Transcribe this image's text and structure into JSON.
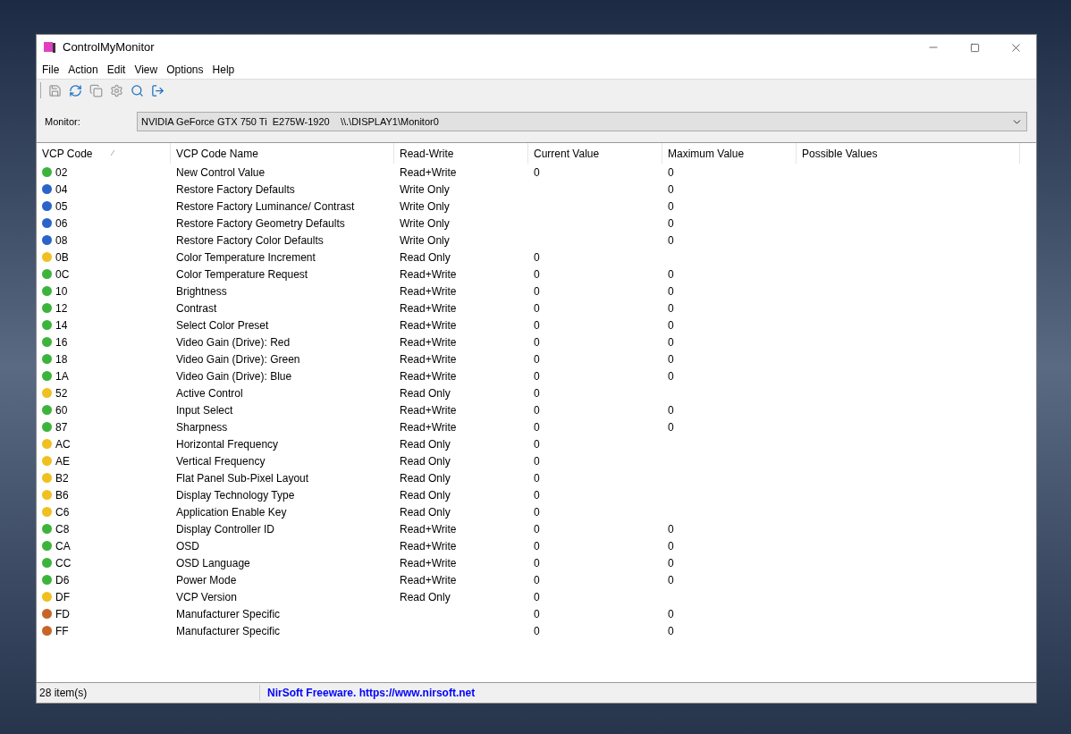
{
  "window": {
    "title": "ControlMyMonitor"
  },
  "menu": [
    "File",
    "Action",
    "Edit",
    "View",
    "Options",
    "Help"
  ],
  "toolbar": [
    {
      "kind": "save",
      "disabled": true
    },
    {
      "kind": "refresh",
      "disabled": false
    },
    {
      "kind": "copy",
      "disabled": true
    },
    {
      "kind": "properties",
      "disabled": true
    },
    {
      "kind": "find",
      "disabled": false
    },
    {
      "kind": "exit",
      "disabled": false
    }
  ],
  "monitor": {
    "label": "Monitor:",
    "value": "NVIDIA GeForce GTX 750 Ti  E275W-1920    \\\\.\\DISPLAY1\\Monitor0"
  },
  "table": {
    "columns": [
      "VCP Code",
      "VCP Code Name",
      "Read-Write",
      "Current Value",
      "Maximum Value",
      "Possible Values"
    ],
    "sort_mark": "⁄",
    "rows": [
      {
        "code": "02",
        "name": "New Control Value",
        "rw": "Read+Write",
        "current": "0",
        "max": "0",
        "color": "#3cb43c"
      },
      {
        "code": "04",
        "name": "Restore Factory Defaults",
        "rw": "Write Only",
        "current": "",
        "max": "0",
        "color": "#2a64c8"
      },
      {
        "code": "05",
        "name": "Restore Factory Luminance/ Contrast",
        "rw": "Write Only",
        "current": "",
        "max": "0",
        "color": "#2a64c8"
      },
      {
        "code": "06",
        "name": "Restore Factory Geometry Defaults",
        "rw": "Write Only",
        "current": "",
        "max": "0",
        "color": "#2a64c8"
      },
      {
        "code": "08",
        "name": "Restore Factory Color Defaults",
        "rw": "Write Only",
        "current": "",
        "max": "0",
        "color": "#2a64c8"
      },
      {
        "code": "0B",
        "name": "Color Temperature Increment",
        "rw": "Read Only",
        "current": "0",
        "max": "",
        "color": "#f0c020"
      },
      {
        "code": "0C",
        "name": "Color Temperature Request",
        "rw": "Read+Write",
        "current": "0",
        "max": "0",
        "color": "#3cb43c"
      },
      {
        "code": "10",
        "name": "Brightness",
        "rw": "Read+Write",
        "current": "0",
        "max": "0",
        "color": "#3cb43c"
      },
      {
        "code": "12",
        "name": "Contrast",
        "rw": "Read+Write",
        "current": "0",
        "max": "0",
        "color": "#3cb43c"
      },
      {
        "code": "14",
        "name": "Select Color Preset",
        "rw": "Read+Write",
        "current": "0",
        "max": "0",
        "color": "#3cb43c"
      },
      {
        "code": "16",
        "name": "Video Gain (Drive): Red",
        "rw": "Read+Write",
        "current": "0",
        "max": "0",
        "color": "#3cb43c"
      },
      {
        "code": "18",
        "name": "Video Gain (Drive): Green",
        "rw": "Read+Write",
        "current": "0",
        "max": "0",
        "color": "#3cb43c"
      },
      {
        "code": "1A",
        "name": "Video Gain (Drive): Blue",
        "rw": "Read+Write",
        "current": "0",
        "max": "0",
        "color": "#3cb43c"
      },
      {
        "code": "52",
        "name": "Active Control",
        "rw": "Read Only",
        "current": "0",
        "max": "",
        "color": "#f0c020"
      },
      {
        "code": "60",
        "name": "Input Select",
        "rw": "Read+Write",
        "current": "0",
        "max": "0",
        "color": "#3cb43c"
      },
      {
        "code": "87",
        "name": "Sharpness",
        "rw": "Read+Write",
        "current": "0",
        "max": "0",
        "color": "#3cb43c"
      },
      {
        "code": "AC",
        "name": "Horizontal Frequency",
        "rw": "Read Only",
        "current": "0",
        "max": "",
        "color": "#f0c020"
      },
      {
        "code": "AE",
        "name": "Vertical Frequency",
        "rw": "Read Only",
        "current": "0",
        "max": "",
        "color": "#f0c020"
      },
      {
        "code": "B2",
        "name": "Flat Panel Sub-Pixel Layout",
        "rw": "Read Only",
        "current": "0",
        "max": "",
        "color": "#f0c020"
      },
      {
        "code": "B6",
        "name": "Display Technology Type",
        "rw": "Read Only",
        "current": "0",
        "max": "",
        "color": "#f0c020"
      },
      {
        "code": "C6",
        "name": "Application Enable Key",
        "rw": "Read Only",
        "current": "0",
        "max": "",
        "color": "#f0c020"
      },
      {
        "code": "C8",
        "name": "Display Controller ID",
        "rw": "Read+Write",
        "current": "0",
        "max": "0",
        "color": "#3cb43c"
      },
      {
        "code": "CA",
        "name": "OSD",
        "rw": "Read+Write",
        "current": "0",
        "max": "0",
        "color": "#3cb43c"
      },
      {
        "code": "CC",
        "name": "OSD Language",
        "rw": "Read+Write",
        "current": "0",
        "max": "0",
        "color": "#3cb43c"
      },
      {
        "code": "D6",
        "name": "Power Mode",
        "rw": "Read+Write",
        "current": "0",
        "max": "0",
        "color": "#3cb43c"
      },
      {
        "code": "DF",
        "name": "VCP Version",
        "rw": "Read Only",
        "current": "0",
        "max": "",
        "color": "#f0c020"
      },
      {
        "code": "FD",
        "name": "Manufacturer Specific",
        "rw": "",
        "current": "0",
        "max": "0",
        "color": "#c86428"
      },
      {
        "code": "FF",
        "name": "Manufacturer Specific",
        "rw": "",
        "current": "0",
        "max": "0",
        "color": "#c86428"
      }
    ]
  },
  "status_bar": {
    "count": "28 item(s)",
    "link": "NirSoft Freeware. https://www.nirsoft.net"
  }
}
